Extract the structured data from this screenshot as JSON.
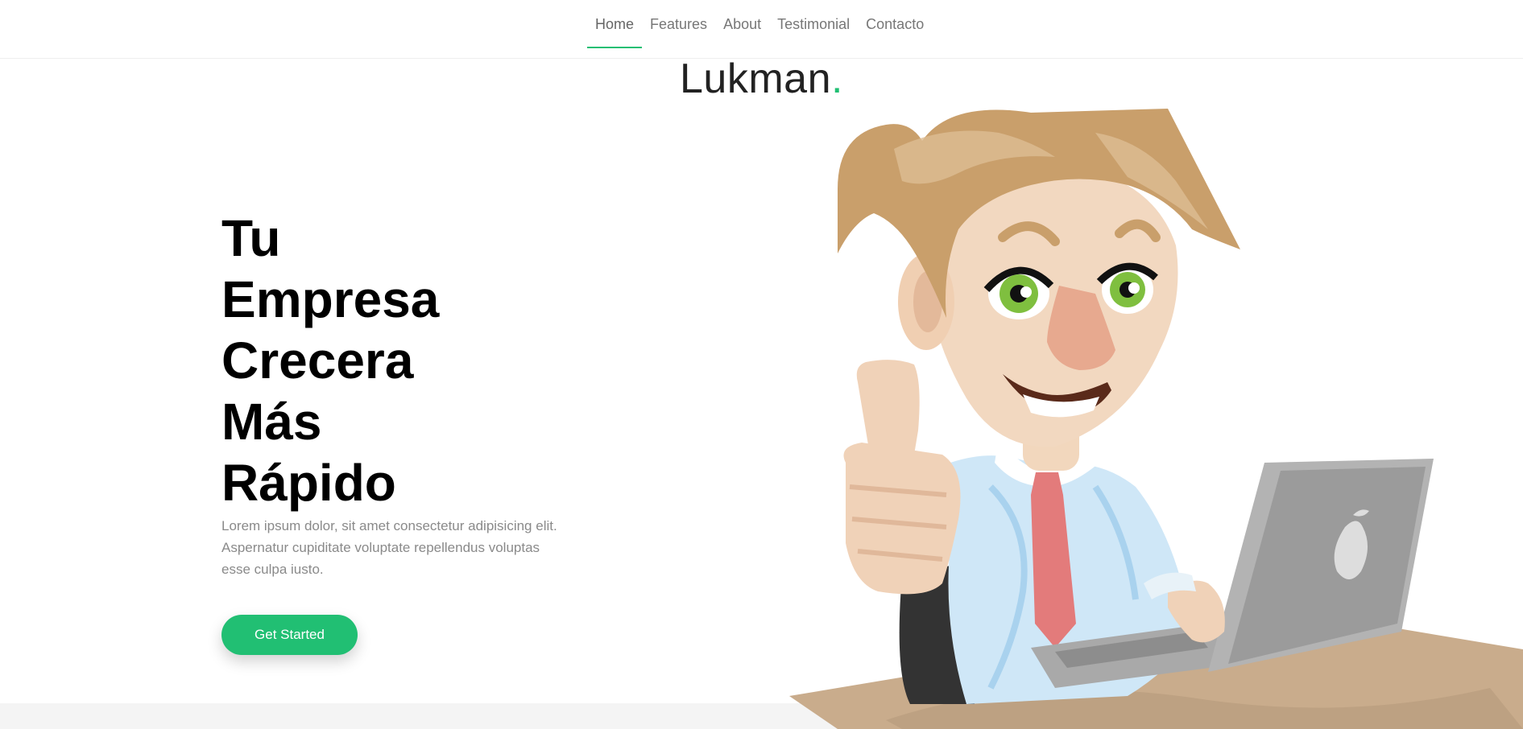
{
  "nav": {
    "items": [
      {
        "label": "Home",
        "active": true
      },
      {
        "label": "Features",
        "active": false
      },
      {
        "label": "About",
        "active": false
      },
      {
        "label": "Testimonial",
        "active": false
      },
      {
        "label": "Contacto",
        "active": false
      }
    ],
    "accent": "#21bf73"
  },
  "brand": {
    "name": "Lukman",
    "dot": "."
  },
  "hero": {
    "title_lines": [
      "Tu",
      "Empresa",
      "Crecera",
      "Más",
      "Rápido"
    ],
    "description": "Lorem ipsum dolor, sit amet consectetur adipisicing elit. Aspernatur cupiditate voluptate repellendus voluptas esse culpa iusto.",
    "cta_label": "Get Started"
  },
  "illustration": {
    "icon": "businessman-laptop-thumbs-up-illustration"
  }
}
